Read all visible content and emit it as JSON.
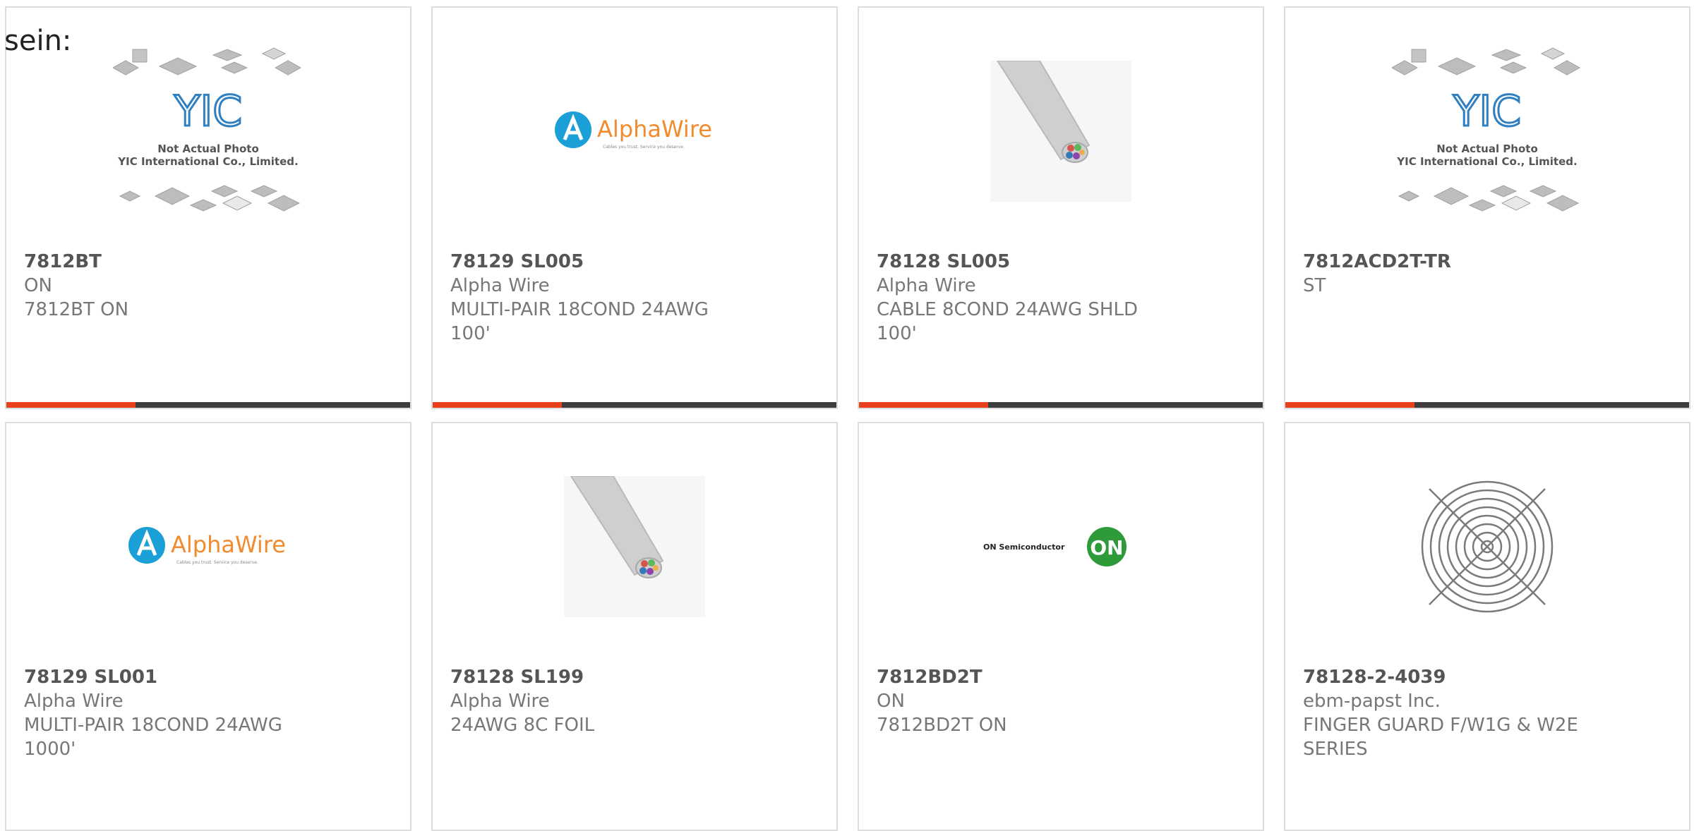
{
  "lead_text": "sein:",
  "colors": {
    "accent": "#e8401c",
    "bar": "#3d3d3d",
    "card_border": "#dddddd",
    "alphawire_blue": "#1a9fd6",
    "alphawire_orange": "#f28a2e",
    "on_green": "#2e9a3a"
  },
  "products": [
    {
      "part": "7812BT",
      "manufacturer": "ON",
      "description": "7812BT ON",
      "image": "yic-placeholder-image",
      "image_caption": {
        "line1": "Not Actual Photo",
        "line2": "YIC International Co., Limited."
      },
      "logo_text": "YIC"
    },
    {
      "part": "78129 SL005",
      "manufacturer": "Alpha Wire",
      "description": "MULTI-PAIR 18COND 24AWG 100'",
      "image": "alphawire-logo",
      "logo_text": "AlphaWire",
      "logo_tagline": "Cables you trust. Service you deserve."
    },
    {
      "part": "78128 SL005",
      "manufacturer": "Alpha Wire",
      "description": "CABLE 8COND 24AWG SHLD 100'",
      "image": "cable-photo"
    },
    {
      "part": "7812ACD2T-TR",
      "manufacturer": "ST",
      "description": "",
      "image": "yic-placeholder-image",
      "image_caption": {
        "line1": "Not Actual Photo",
        "line2": "YIC International Co., Limited."
      },
      "logo_text": "YIC"
    },
    {
      "part": "78129 SL001",
      "manufacturer": "Alpha Wire",
      "description": "MULTI-PAIR 18COND 24AWG 1000'",
      "image": "alphawire-logo",
      "logo_text": "AlphaWire",
      "logo_tagline": "Cables you trust. Service you deserve."
    },
    {
      "part": "78128 SL199",
      "manufacturer": "Alpha Wire",
      "description": "24AWG 8C FOIL",
      "image": "cable-photo"
    },
    {
      "part": "7812BD2T",
      "manufacturer": "ON",
      "description": "7812BD2T ON",
      "image": "on-semiconductor-logo",
      "logo_text": "ON Semiconductor",
      "logo_badge": "ON"
    },
    {
      "part": "78128-2-4039",
      "manufacturer": "ebm-papst Inc.",
      "description": "FINGER GUARD F/W1G & W2E SERIES",
      "image": "finger-guard-photo"
    }
  ]
}
